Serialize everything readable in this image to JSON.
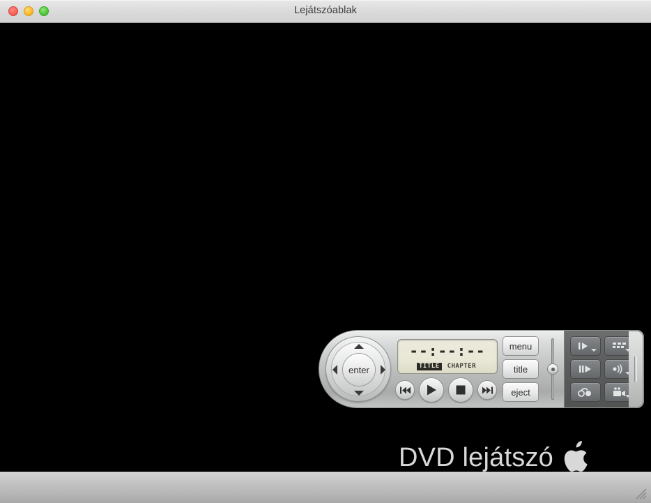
{
  "window": {
    "title": "Lejátszóablak",
    "traffic_lights": [
      {
        "name": "close",
        "color": "#f9655c"
      },
      {
        "name": "minimize",
        "color": "#fdbc2e"
      },
      {
        "name": "zoom",
        "color": "#56c83f"
      }
    ]
  },
  "stage": {
    "background_color": "#000000",
    "brand": {
      "text": "DVD lejátszó",
      "logo": "apple-logo",
      "color": "#d8d8d8"
    }
  },
  "controller": {
    "name": "dvd-controller",
    "dpad": {
      "center_label": "enter",
      "up_label": "up",
      "down_label": "down",
      "left_label": "left",
      "right_label": "right"
    },
    "lcd": {
      "time": "--:--:--",
      "title_label": "TITLE",
      "title_active": true,
      "chapter_label": "CHAPTER",
      "chapter_active": false,
      "background_color": "#e9e7d6",
      "text_color": "#2b2b26"
    },
    "transport": [
      {
        "name": "previous-chapter-button",
        "icon": "skip-back-icon",
        "size": "small"
      },
      {
        "name": "play-button",
        "icon": "play-icon",
        "size": "big"
      },
      {
        "name": "stop-button",
        "icon": "stop-icon",
        "size": "big"
      },
      {
        "name": "next-chapter-button",
        "icon": "skip-forward-icon",
        "size": "small"
      }
    ],
    "side_buttons": [
      {
        "name": "menu-button",
        "label": "menu"
      },
      {
        "name": "title-button",
        "label": "title"
      },
      {
        "name": "eject-button",
        "label": "eject"
      }
    ],
    "volume_slider": {
      "name": "volume-slider",
      "value_percent": 50
    },
    "feature_buttons": [
      {
        "name": "slow-motion-button",
        "icon": "slow-motion-icon",
        "has_menu": true
      },
      {
        "name": "subtitle-button",
        "icon": "subtitle-icon",
        "has_menu": true
      },
      {
        "name": "step-frame-button",
        "icon": "step-frame-icon",
        "has_menu": false
      },
      {
        "name": "audio-button",
        "icon": "audio-icon",
        "has_menu": true
      },
      {
        "name": "bookmark-button",
        "icon": "bookmark-icon",
        "has_menu": false
      },
      {
        "name": "camera-angle-button",
        "icon": "camera-angle-icon",
        "has_menu": true
      }
    ],
    "drag_handle": {
      "name": "controller-drag-handle"
    }
  },
  "bottom_bar": {
    "resize_grip": "resize-grip-icon"
  }
}
